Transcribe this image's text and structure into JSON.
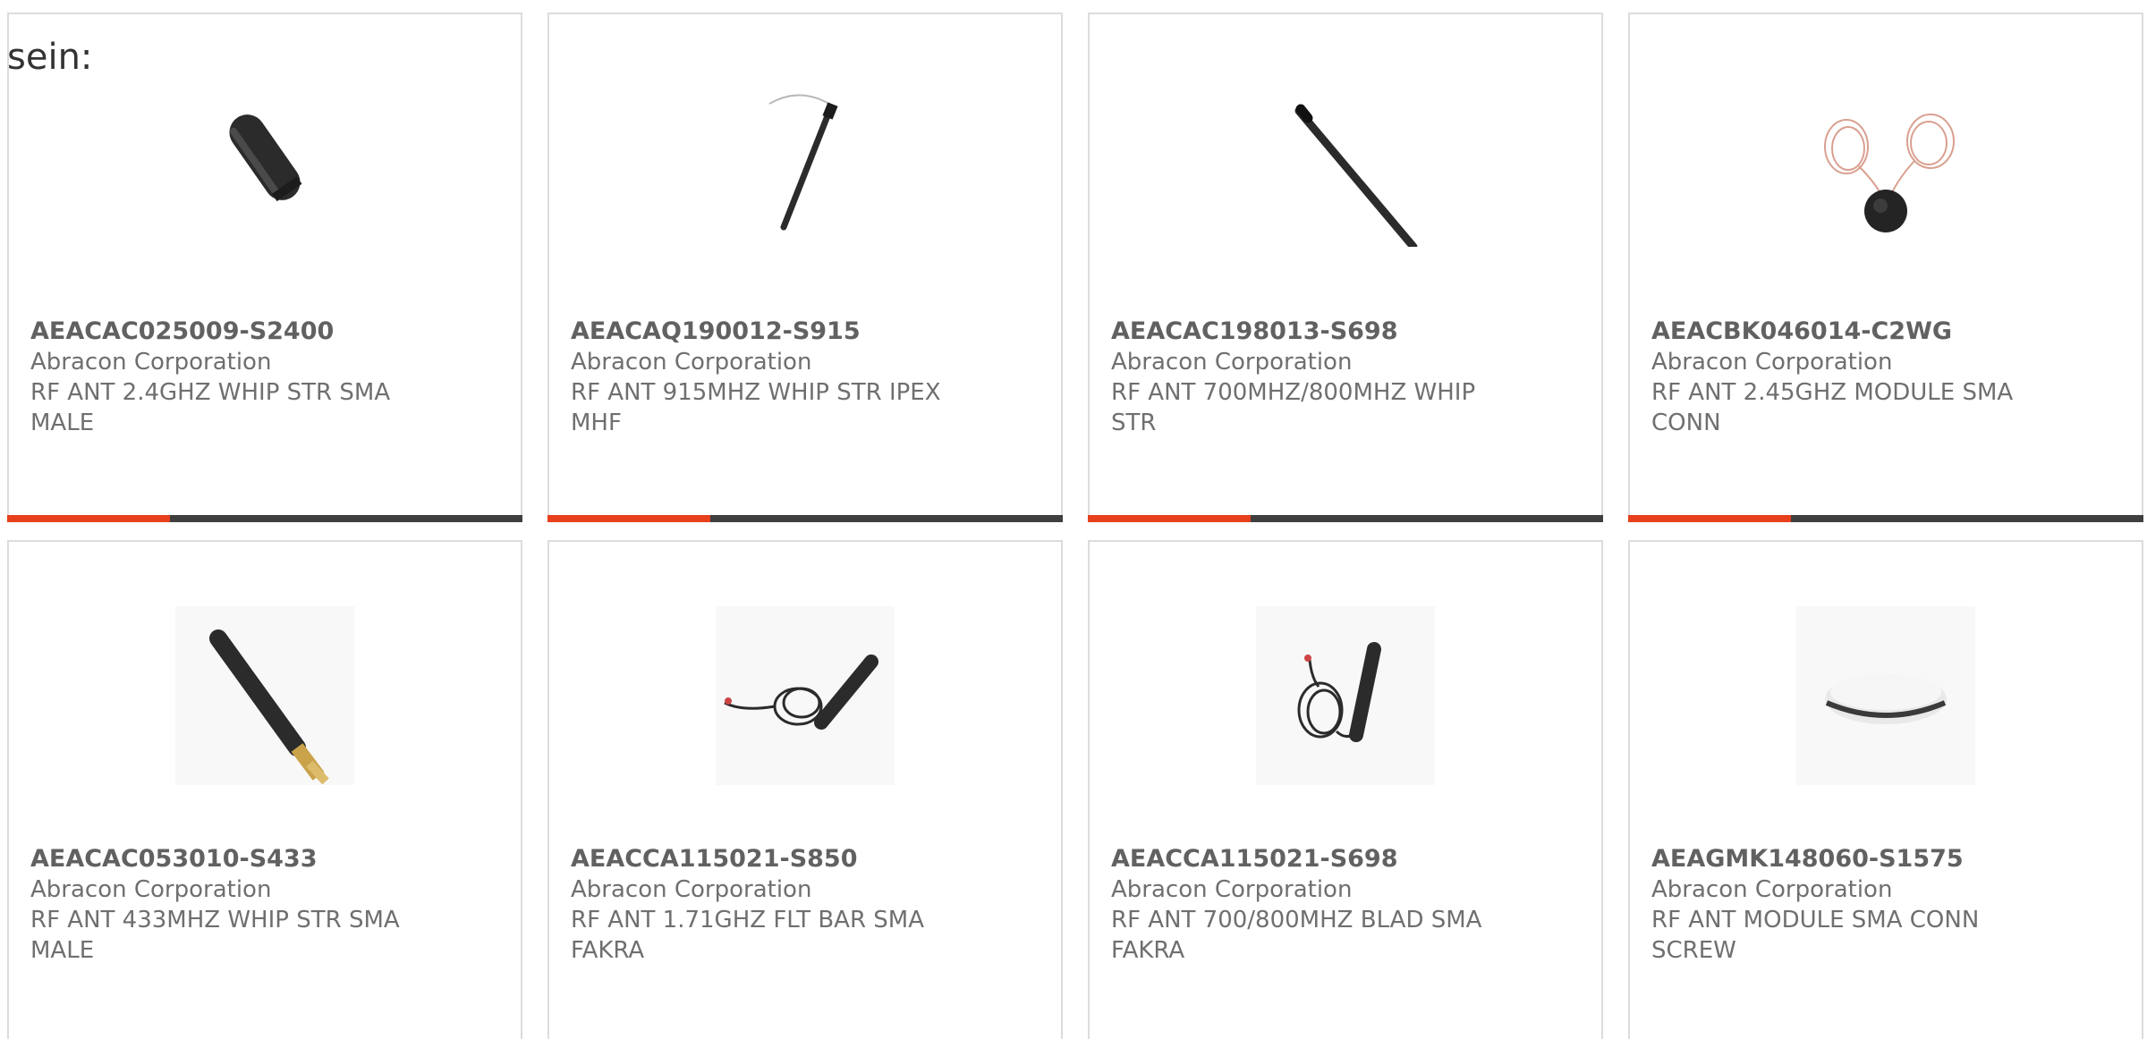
{
  "intro_text": "sein:",
  "colors": {
    "accent": "#e8401c",
    "bar": "#3f3f3f",
    "card_border": "#dcdcdc"
  },
  "products": [
    {
      "part_number": "AEACAC025009-S2400",
      "manufacturer": "Abracon Corporation",
      "description": "RF ANT 2.4GHZ WHIP STR SMA MALE",
      "image": "stubby-antenna-icon"
    },
    {
      "part_number": "AEACAQ190012-S915",
      "manufacturer": "Abracon Corporation",
      "description": "RF ANT 915MHZ WHIP STR IPEX MHF",
      "image": "whip-antenna-cable-icon"
    },
    {
      "part_number": "AEACAC198013-S698",
      "manufacturer": "Abracon Corporation",
      "description": "RF ANT 700MHZ/800MHZ WHIP STR",
      "image": "long-whip-antenna-icon"
    },
    {
      "part_number": "AEACBK046014-C2WG",
      "manufacturer": "Abracon Corporation",
      "description": "RF ANT 2.45GHZ MODULE SMA CONN",
      "image": "puck-antenna-dual-cable-icon"
    },
    {
      "part_number": "AEACAC053010-S433",
      "manufacturer": "Abracon Corporation",
      "description": "RF ANT 433MHZ WHIP STR SMA MALE",
      "image": "sma-whip-antenna-icon"
    },
    {
      "part_number": "AEACCA115021-S850",
      "manufacturer": "Abracon Corporation",
      "description": "RF ANT 1.71GHZ FLT BAR SMA FAKRA",
      "image": "bar-antenna-coiled-cable-icon"
    },
    {
      "part_number": "AEACCA115021-S698",
      "manufacturer": "Abracon Corporation",
      "description": "RF ANT 700/800MHZ BLAD SMA FAKRA",
      "image": "blade-antenna-coiled-cable-icon"
    },
    {
      "part_number": "AEAGMK148060-S1575",
      "manufacturer": "Abracon Corporation",
      "description": "RF ANT MODULE SMA CONN SCREW",
      "image": "dome-gps-antenna-icon"
    }
  ]
}
